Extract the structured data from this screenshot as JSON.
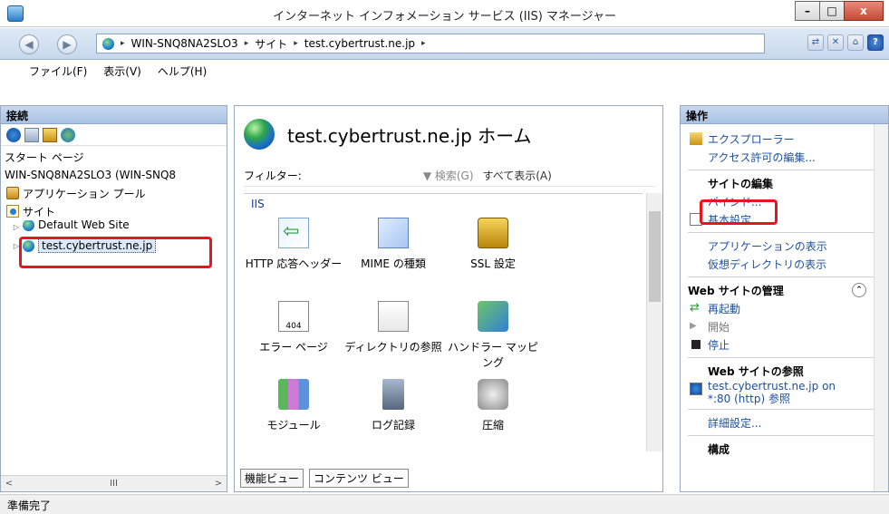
{
  "window": {
    "title": "インターネット インフォメーション サービス (IIS) マネージャー",
    "minimize": "–",
    "maximize": "□",
    "close": "x"
  },
  "address": {
    "back_icon": "◀",
    "fwd_icon": "▶",
    "crumbs": [
      "WIN-SNQ8NA2SLO3",
      "サイト",
      "test.cybertrust.ne.jp"
    ],
    "sep": "▸",
    "help": "?"
  },
  "menu": [
    "ファイル(F)",
    "表示(V)",
    "ヘルプ(H)"
  ],
  "connections": {
    "title": "接続",
    "tree": {
      "start_page": "スタート ページ",
      "server": "WIN-SNQ8NA2SLO3 (WIN-SNQ8",
      "app_pools": "アプリケーション プール",
      "sites": "サイト",
      "default_site": "Default Web Site",
      "selected_site": "test.cybertrust.ne.jp"
    },
    "scroll_mid": "III"
  },
  "center": {
    "title": "test.cybertrust.ne.jp ホーム",
    "filter_label": "フィルター:",
    "search": "▼ 検索(G)",
    "show_all": "すべて表示(A)",
    "group": "IIS",
    "features": [
      {
        "label": "HTTP 応答ヘッダー",
        "icon": "http-response-headers-icon"
      },
      {
        "label": "MIME の種類",
        "icon": "mime-types-icon"
      },
      {
        "label": "SSL 設定",
        "icon": "ssl-settings-icon"
      },
      {
        "label": "エラー ページ",
        "icon": "error-pages-icon"
      },
      {
        "label": "ディレクトリの参照",
        "icon": "directory-browsing-icon"
      },
      {
        "label": "ハンドラー マッピング",
        "icon": "handler-mappings-icon"
      },
      {
        "label": "モジュール",
        "icon": "modules-icon"
      },
      {
        "label": "ログ記録",
        "icon": "logging-icon"
      },
      {
        "label": "圧縮",
        "icon": "compression-icon"
      }
    ],
    "tabs": {
      "features_view": "機能ビュー",
      "content_view": "コンテンツ ビュー"
    }
  },
  "actions": {
    "title": "操作",
    "explorer": "エクスプローラー",
    "edit_permissions": "アクセス許可の編集...",
    "edit_site_header": "サイトの編集",
    "bindings": "バインド...",
    "basic_settings": "基本設定...",
    "view_applications": "アプリケーションの表示",
    "view_virtual_dirs": "仮想ディレクトリの表示",
    "manage_header": "Web サイトの管理",
    "restart": "再起動",
    "start": "開始",
    "stop": "停止",
    "browse_header": "Web サイトの参照",
    "browse_link_line1": "test.cybertrust.ne.jp on",
    "browse_link_line2": "*:80 (http) 参照",
    "advanced_settings": "詳細設定...",
    "config_header": "構成"
  },
  "status": {
    "text": "準備完了"
  },
  "colors": {
    "highlight": "#e8141e",
    "link": "#1d4f9c"
  }
}
